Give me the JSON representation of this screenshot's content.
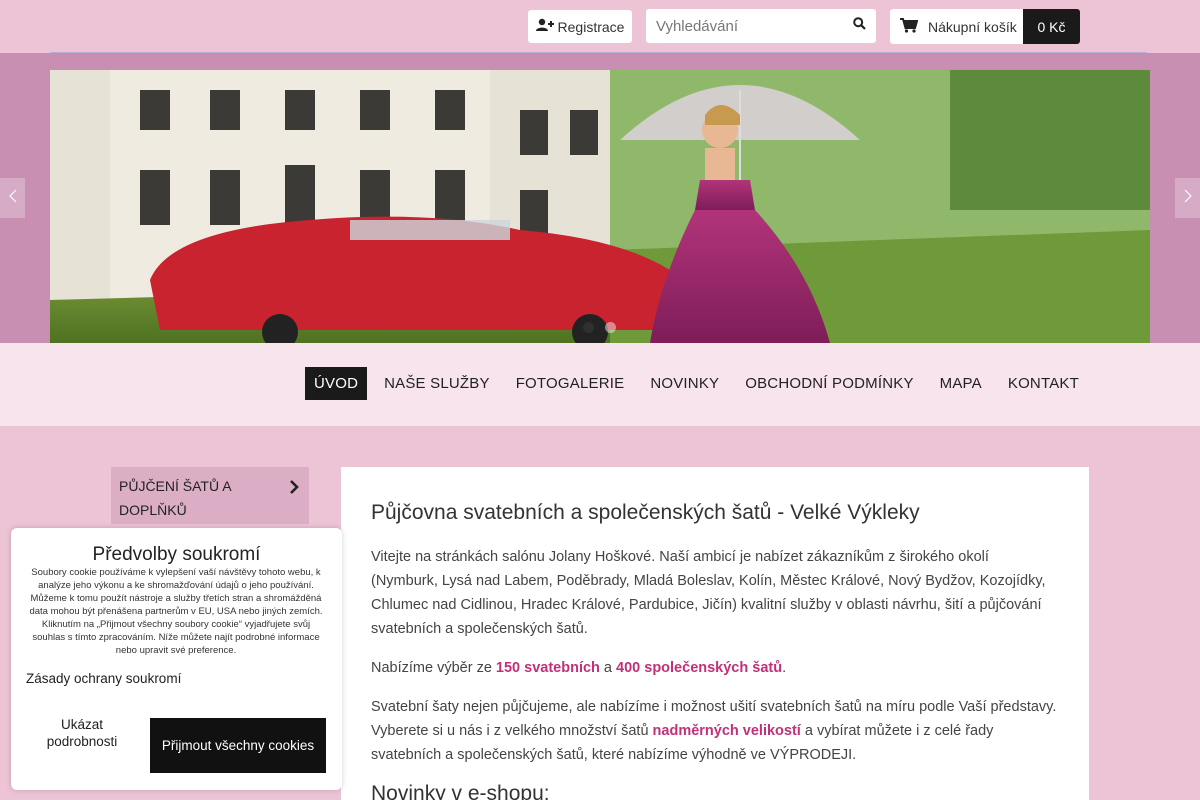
{
  "topbar": {
    "register_label": "Registrace",
    "search_placeholder": "Vyhledávání",
    "cart_label": "Nákupní košík",
    "cart_total": "0 Kč"
  },
  "slider": {
    "slides": 2,
    "active": 1
  },
  "nav": {
    "items": [
      "ÚVOD",
      "NAŠE SLUŽBY",
      "FOTOGALERIE",
      "NOVINKY",
      "OBCHODNÍ PODMÍNKY",
      "MAPA",
      "KONTAKT"
    ]
  },
  "sidebar": {
    "category_label": "PŮJČENÍ ŠATŮ A DOPLŇKŮ"
  },
  "main": {
    "title": "Půjčovna svatebních a společenských šatů - Velké Výkleky",
    "intro": "Vitejte na stránkách salónu Jolany Hoškové. Naší ambicí je nabízet zákazníkům z širokého okolí (Nymburk, Lysá nad Labem, Poděbrady, Mladá Boleslav, Kolín, Městec Králové, Nový Bydžov, Kozojídky, Chlumec nad Cidlinou, Hradec Králové, Pardubice, Jičín) kvalitní služby v oblasti návrhu, šití a půjčování svatebních a společenských šatů.",
    "offer_prefix": "Nabízíme výběr ze ",
    "offer_wedding": "150 svatebních",
    "offer_and": " a ",
    "offer_social": "400 společenských šatů",
    "offer_suffix": ".",
    "custom_prefix": "Svatební šaty nejen půjčujeme, ale nabízíme i možnost ušití svatebních šatů na míru podle Vaší představy. Vyberete si u nás i z velkého množství šatů ",
    "custom_link": "nadměrných velikostí",
    "custom_suffix": " a vybírat můžete i z celé řady svatebních a společenských šatů, které nabízíme výhodně ve VÝPRODEJI.",
    "news_heading": "Novinky v e-shopu:"
  },
  "cookie": {
    "title": "Předvolby soukromí",
    "text": "Soubory cookie používáme k vylepšení vaší návštěvy tohoto webu, k analýze jeho výkonu a ke shromažďování údajů o jeho používání. Můžeme k tomu použít nástroje a služby třetích stran a shromážděná data mohou být přenášena partnerům v EU, USA nebo jiných zemích. Kliknutím na „Přijmout všechny soubory cookie“ vyjadřujete svůj souhlas s tímto zpracováním. Níže můžete najít podrobné informace nebo upravit své preference.",
    "policy_link": "Zásady ochrany soukromí",
    "details_label": "Ukázat podrobnosti",
    "accept_label": "Přijmout všechny cookies"
  },
  "colors": {
    "page_bg": "#ecc4d6",
    "nav_bg": "#f7e4ed",
    "highlight": "#c2307a",
    "dark": "#1a1a1a"
  }
}
